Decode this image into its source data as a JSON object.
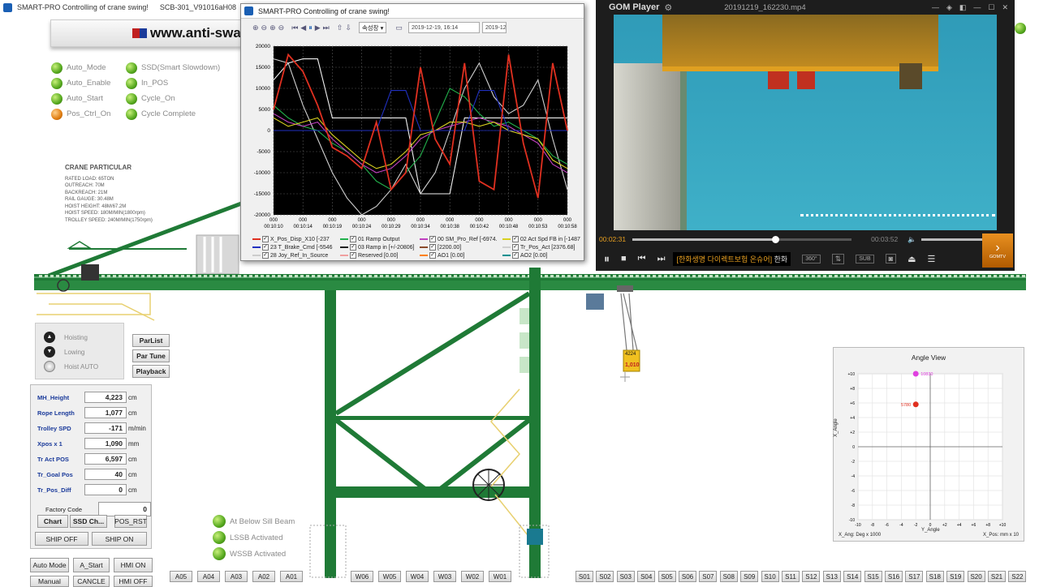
{
  "main_window": {
    "title": "SMART-PRO  Controlling of crane swing!",
    "title_extra": "SCB-301_V91016aH08",
    "brand_url": "www.anti-swa"
  },
  "status": [
    {
      "label": "Auto_Mode",
      "state": "on"
    },
    {
      "label": "Auto_Enable",
      "state": "on"
    },
    {
      "label": "Auto_Start",
      "state": "on"
    },
    {
      "label": "Pos_Ctrl_On",
      "state": "off"
    }
  ],
  "status2": [
    {
      "label": "SSD(Smart Slowdown)"
    },
    {
      "label": "In_POS"
    },
    {
      "label": "Cycle_On"
    },
    {
      "label": "Cycle Complete"
    }
  ],
  "particular": {
    "title": "CRANE PARTICULAR",
    "lines": [
      "RATED LOAD: 65TON",
      "OUTREACH: 70M",
      "BACKREACH: 21M",
      "RAIL GAUGE: 30.48M",
      "HOIST HEIGHT: 48M/67.2M",
      "HOIST SPEED: 180M/MIN(1800rpm)",
      "TROLLEY SPEED: 240M/MIN(1750rpm)"
    ]
  },
  "hoist": {
    "hoisting": "Hoisting",
    "lowing": "Lowing",
    "auto": "Hoist  AUTO"
  },
  "side_buttons": {
    "parlist": "ParList",
    "partune": "Par Tune",
    "playback": "Playback"
  },
  "hmi": [
    {
      "label": "MH_Height",
      "value": "4,223",
      "unit": "cm"
    },
    {
      "label": "Rope Length",
      "value": "1,077",
      "unit": "cm"
    },
    {
      "label": "Trolley SPD",
      "value": "-171",
      "unit": "m/min"
    },
    {
      "label": "Xpos x 1",
      "value": "1,090",
      "unit": "mm"
    },
    {
      "label": "Tr Act POS",
      "value": "6,597",
      "unit": "cm"
    },
    {
      "label": "Tr_Goal Pos",
      "value": "40",
      "unit": "cm"
    },
    {
      "label": "Tr_Pos_Diff",
      "value": "0",
      "unit": "cm"
    }
  ],
  "factory": {
    "label": "Factory Code",
    "value": "0"
  },
  "action_buttons": {
    "chart": "Chart",
    "ssd": "SSD Ch...",
    "posrst": "POS_RST",
    "shipoff": "SHIP OFF",
    "shipon": "SHIP ON"
  },
  "bottom_left": {
    "automode": "Auto Mode",
    "astart": "A_Start",
    "hmion": "HMI ON",
    "manual": "Manual",
    "cancle": "CANCLE",
    "hmioff": "HMI OFF"
  },
  "beam_status": [
    "At Below Sill Beam",
    "LSSB Activated",
    "WSSB Activated"
  ],
  "spot_buttons_a": [
    "A05",
    "A04",
    "A03",
    "A02",
    "A01"
  ],
  "spot_buttons_w": [
    "W06",
    "W05",
    "W04",
    "W03",
    "W02",
    "W01"
  ],
  "spot_buttons_s": [
    "S01",
    "S02",
    "S03",
    "S04",
    "S05",
    "S06",
    "S07",
    "S08",
    "S09",
    "S10",
    "S11",
    "S12",
    "S13",
    "S14",
    "S15",
    "S16",
    "S17",
    "S18",
    "S19",
    "S20",
    "S21",
    "S22"
  ],
  "hook_labels": {
    "top": "4224",
    "bottom": "1,010"
  },
  "chart_window": {
    "title": "SMART-PRO  Controlling of crane swing!",
    "dropdown": "속성창",
    "date1": "2019-12-19,  16:14",
    "date2": "2019-12"
  },
  "chart_data": {
    "type": "line",
    "ylim": [
      -20000,
      20000
    ],
    "yticks": [
      "20000",
      "15000",
      "10000",
      "5000",
      "0",
      "-5000",
      "-10000",
      "-15000",
      "-20000"
    ],
    "xticks_top": [
      "000",
      "000",
      "000",
      "000",
      "000",
      "000",
      "000",
      "000",
      "000",
      "000",
      "000"
    ],
    "xticks": [
      "00:10:10",
      "00:10:14",
      "00:10:19",
      "00:10:24",
      "00:10:29",
      "00:10:34",
      "00:10:38",
      "00:10:42",
      "00:10:48",
      "00:10:53",
      "00:10:58"
    ],
    "grid": true,
    "legend_position": "bottom",
    "series": [
      {
        "name": "X_Pos_Disp_X10 [-237",
        "color": "#e03020",
        "values": [
          5000,
          18000,
          14000,
          6000,
          -4000,
          -6000,
          -9000,
          2000,
          -14000,
          -10000,
          15000,
          -2000,
          -8000,
          16000,
          -12000,
          -14000,
          18000,
          -3000,
          -16000,
          16000,
          0
        ]
      },
      {
        "name": "01 Ramp Output",
        "color": "#22b14c",
        "values": [
          6000,
          3000,
          1000,
          0,
          -3000,
          -5000,
          -8000,
          -12000,
          -14000,
          -10000,
          -6000,
          2000,
          10000,
          8000,
          4000,
          1000,
          2000,
          0,
          -2000,
          -6000,
          -8000
        ]
      },
      {
        "name": "00 SM_Pro_Ref [-6974.",
        "color": "#c040c0",
        "values": [
          4000,
          2000,
          1000,
          2000,
          -2000,
          -5000,
          -8000,
          -10000,
          -9000,
          -6000,
          -2000,
          0,
          1000,
          2000,
          3000,
          2000,
          1000,
          -1000,
          -3000,
          -8000,
          -10000
        ]
      },
      {
        "name": "02 Act Spd FB in [-1487",
        "color": "#d8d020",
        "values": [
          3000,
          1000,
          2000,
          3000,
          -1000,
          -4000,
          -7000,
          -9000,
          -8000,
          -5000,
          -1000,
          0,
          2000,
          2000,
          1000,
          2000,
          0,
          -1000,
          -2000,
          -7000,
          -9000
        ]
      },
      {
        "name": "23 T_Brake_Cmd [-5546",
        "color": "#2030c0",
        "values": [
          0,
          0,
          0,
          0,
          0,
          0,
          0,
          0,
          9500,
          9500,
          0,
          0,
          0,
          0,
          9500,
          9500,
          0,
          0,
          0,
          0,
          0
        ]
      },
      {
        "name": "03 Ramp in [+/-20806]",
        "color": "#202020",
        "values": [
          0,
          0,
          0,
          0,
          0,
          0,
          0,
          0,
          0,
          0,
          0,
          0,
          0,
          0,
          0,
          0,
          0,
          0,
          0,
          0,
          0
        ]
      },
      {
        "name": "[2200.00]",
        "color": "#8a4a2a",
        "values": [
          2200,
          2200,
          2200,
          2200,
          2200,
          2200,
          2200,
          2200,
          2200,
          2200,
          2200,
          2200,
          2200,
          2200,
          2200,
          2200,
          2200,
          2200,
          2200,
          2200,
          2200
        ]
      },
      {
        "name": "Tr_Pos_Act [2376.68]",
        "color": "#d0d0d0",
        "values": [
          17000,
          16000,
          6000,
          -2000,
          -10000,
          -16000,
          -20000,
          -18000,
          -14000,
          -8000,
          -15000,
          -10000,
          0,
          10000,
          16000,
          8000,
          4000,
          6000,
          12000,
          -2000,
          -14000
        ]
      },
      {
        "name": "28 Joy_Ref_In_Source",
        "color": "#f0f0f0",
        "values": [
          12000,
          16000,
          17000,
          17000,
          3000,
          3000,
          3000,
          3000,
          3000,
          3000,
          -15000,
          -15000,
          -15000,
          3000,
          3000,
          3000,
          3000,
          3000,
          3000,
          3000,
          3000
        ]
      },
      {
        "name": "Reserved [0.00]",
        "color": "#f0a0a0",
        "values": [
          0,
          0,
          0,
          0,
          0,
          0,
          0,
          0,
          0,
          0,
          0,
          0,
          0,
          0,
          0,
          0,
          0,
          0,
          0,
          0,
          0
        ]
      },
      {
        "name": "AO1 [0.00]",
        "color": "#ff8000",
        "values": [
          0,
          0,
          0,
          0,
          0,
          0,
          0,
          0,
          0,
          0,
          0,
          0,
          0,
          0,
          0,
          0,
          0,
          0,
          0,
          0,
          0
        ]
      },
      {
        "name": "AO2 [0.00]",
        "color": "#009090",
        "values": [
          0,
          0,
          0,
          0,
          0,
          0,
          0,
          0,
          0,
          0,
          0,
          0,
          0,
          0,
          0,
          0,
          0,
          0,
          0,
          0,
          0
        ]
      }
    ]
  },
  "player": {
    "brand": "GOM Player",
    "file": "20191219_162230.mp4",
    "time_current": "00:02:31",
    "time_total": "00:03:52",
    "progress": 0.65,
    "ticker": "[한화생명 다이렉트보험 온슈어]",
    "ticker2": "한화",
    "btn360": "360°",
    "sub": "SUB",
    "gomtv": "GOMTV"
  },
  "angle_view": {
    "title": "Angle View",
    "y_axis": "X_Angle",
    "x_axis": "Y_Angle",
    "foot_left": "X_Ang: Deg x 1000",
    "foot_right": "X_Pos: mm x 10",
    "point1_label": "10830",
    "point2_label": "5780",
    "ticks_y": [
      "+10",
      "+8",
      "+6",
      "+4",
      "+2",
      "0",
      "-2",
      "-4",
      "-6",
      "-8",
      "-10"
    ],
    "ticks_x": [
      "-10",
      "-8",
      "-6",
      "-4",
      "-2",
      "0",
      "+2",
      "+4",
      "+6",
      "+8",
      "+10"
    ]
  },
  "colors": {
    "crane_green": "#1f7a36",
    "led_green": "#55a81e",
    "led_orange": "#e07d10",
    "hmi_label": "#1a3a9a"
  }
}
